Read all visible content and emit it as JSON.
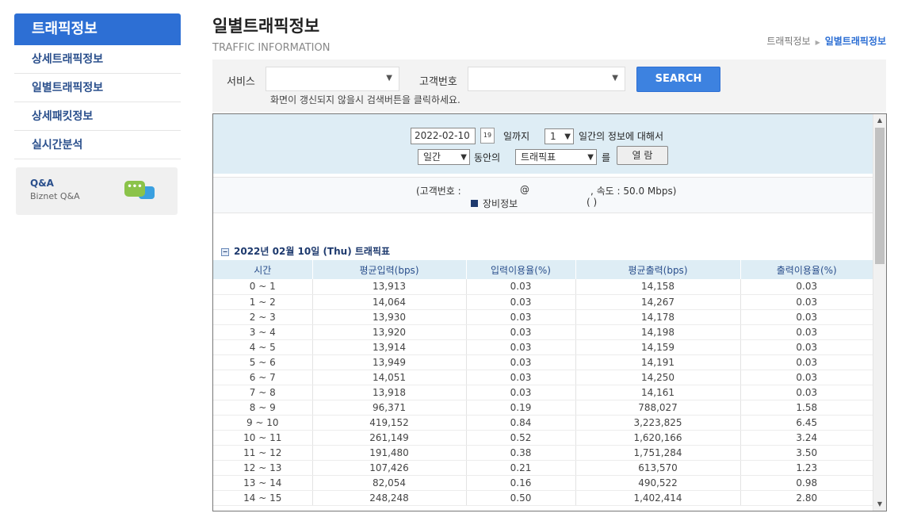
{
  "sidebar": {
    "title": "트래픽정보",
    "items": [
      "상세트래픽정보",
      "일별트래픽정보",
      "상세패킷정보",
      "실시간분석"
    ],
    "qna_title": "Q&A",
    "qna_sub": "Biznet Q&A",
    "qna_icon": "chat-bubbles-icon"
  },
  "header": {
    "title": "일별트래픽정보",
    "subtitle": "TRAFFIC INFORMATION",
    "breadcrumb": [
      "트래픽정보",
      "일별트래픽정보"
    ]
  },
  "search": {
    "service_label": "서비스",
    "service_value": "",
    "customer_label": "고객번호",
    "customer_value": "",
    "button": "SEARCH",
    "hint": "화면이 갱신되지 않을시 검색버튼을 클릭하세요."
  },
  "filter": {
    "date": "2022-02-10",
    "until": "일까지",
    "days": "1",
    "days_suffix": "일간의 정보에 대해서",
    "period": "일간",
    "during": "동안의",
    "report": "트래픽표",
    "particle": "를",
    "view_button": "열 람"
  },
  "info": {
    "customer_label": "(고객번호 :",
    "at": "@",
    "speed": ", 속도 : 50.0 Mbps)",
    "device_label": "장비정보",
    "device_paren": "(          )"
  },
  "table": {
    "title": "2022년 02월 10일 (Thu) 트래픽표",
    "headers": [
      "시간",
      "평균입력(bps)",
      "입력이용율(%)",
      "평균출력(bps)",
      "출력이용율(%)"
    ],
    "rows": [
      [
        "0 ~ 1",
        "13,913",
        "0.03",
        "14,158",
        "0.03"
      ],
      [
        "1 ~ 2",
        "14,064",
        "0.03",
        "14,267",
        "0.03"
      ],
      [
        "2 ~ 3",
        "13,930",
        "0.03",
        "14,178",
        "0.03"
      ],
      [
        "3 ~ 4",
        "13,920",
        "0.03",
        "14,198",
        "0.03"
      ],
      [
        "4 ~ 5",
        "13,914",
        "0.03",
        "14,159",
        "0.03"
      ],
      [
        "5 ~ 6",
        "13,949",
        "0.03",
        "14,191",
        "0.03"
      ],
      [
        "6 ~ 7",
        "14,051",
        "0.03",
        "14,250",
        "0.03"
      ],
      [
        "7 ~ 8",
        "13,918",
        "0.03",
        "14,161",
        "0.03"
      ],
      [
        "8 ~ 9",
        "96,371",
        "0.19",
        "788,027",
        "1.58"
      ],
      [
        "9 ~ 10",
        "419,152",
        "0.84",
        "3,223,825",
        "6.45"
      ],
      [
        "10 ~ 11",
        "261,149",
        "0.52",
        "1,620,166",
        "3.24"
      ],
      [
        "11 ~ 12",
        "191,480",
        "0.38",
        "1,751,284",
        "3.50"
      ],
      [
        "12 ~ 13",
        "107,426",
        "0.21",
        "613,570",
        "1.23"
      ],
      [
        "13 ~ 14",
        "82,054",
        "0.16",
        "490,522",
        "0.98"
      ],
      [
        "14 ~ 15",
        "248,248",
        "0.50",
        "1,402,414",
        "2.80"
      ]
    ]
  }
}
